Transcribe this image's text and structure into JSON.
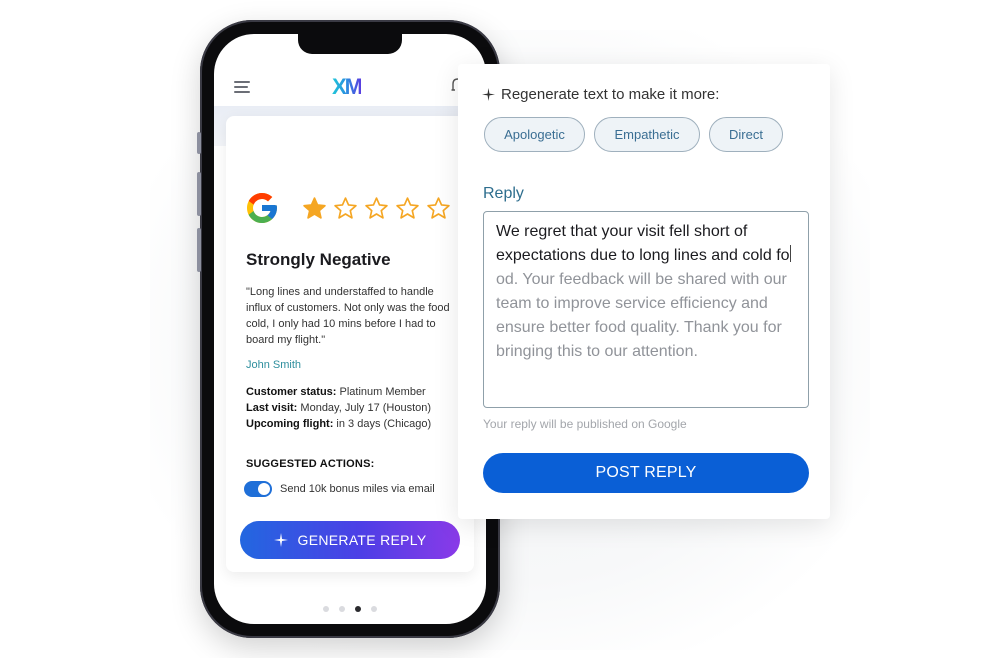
{
  "app": {
    "logo_text": "XM",
    "colors": {
      "brand_gradient_start": "#1fc8d8",
      "brand_gradient_end": "#5a3de0",
      "accent": "#0a5fd6",
      "star": "#f5a623"
    }
  },
  "review": {
    "source_icon": "google-icon",
    "rating": 1,
    "rating_max": 5,
    "sentiment": "Strongly Negative",
    "quote": "\"Long lines and understaffed to handle influx of customers. Not only was the food cold, I only had 10 mins before I had to board my flight.\"",
    "author": "John Smith",
    "meta": [
      {
        "label": "Customer status:",
        "value": " Platinum Member"
      },
      {
        "label": "Last visit:",
        "value": " Monday, July 17 (Houston)"
      },
      {
        "label": "Upcoming flight:",
        "value": " in 3 days (Chicago)"
      }
    ]
  },
  "suggested_actions": {
    "title": "SUGGESTED ACTIONS:",
    "items": [
      {
        "label": "Send 10k bonus miles via email",
        "enabled": true
      }
    ]
  },
  "generate_button": {
    "label": "GENERATE REPLY"
  },
  "pagination": {
    "total": 4,
    "active_index": 2
  },
  "panel": {
    "regenerate_label": "Regenerate text to make it more:",
    "tone_options": [
      "Apologetic",
      "Empathetic",
      "Direct"
    ],
    "reply_label": "Reply",
    "reply_typed": "We regret that your visit fell short of expectations due to long lines and cold fo",
    "reply_pending": "od. Your feedback will be shared with our team to improve service efficiency and ensure better food quality. Thank you for bringing this to our attention.",
    "publish_note": "Your reply will be published on Google",
    "post_button": "POST REPLY"
  }
}
